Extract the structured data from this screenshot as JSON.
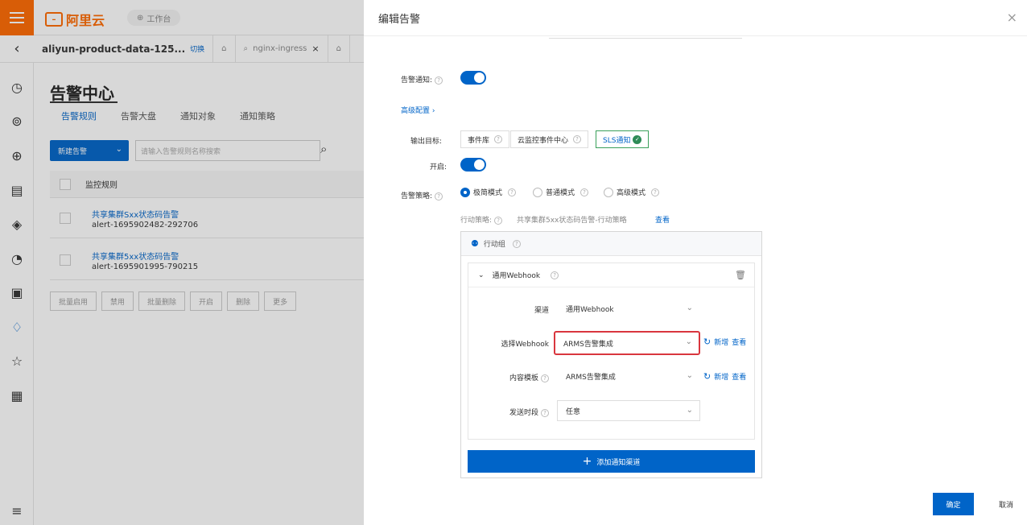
{
  "app": {
    "logo_text": "阿里云",
    "workspace_label": "工作台"
  },
  "tabs": [
    {
      "label": "aliyun-product-data-125...",
      "badge": "切换"
    },
    {
      "label": "nginx-ingress"
    }
  ],
  "page": {
    "title": "告警中心",
    "subtabs": [
      "告警规则",
      "告警大盘",
      "通知对象",
      "通知策略"
    ],
    "new_button": "新建告警",
    "search_placeholder": "请输入告警规则名称搜索",
    "table_header": "监控规则",
    "rows": [
      {
        "name": "共享集群Sxx状态码告警",
        "id": "alert-1695902482-292706"
      },
      {
        "name": "共享集群5xx状态码告警",
        "id": "alert-1695901995-790215"
      }
    ],
    "bulk_actions": [
      "批量启用",
      "禁用",
      "批量删除",
      "开启",
      "删除",
      "更多"
    ]
  },
  "drawer": {
    "title": "编辑告警",
    "notify_label": "告警通知:",
    "advanced_link": "高级配置",
    "output_label": "输出目标:",
    "output_targets": [
      "事件库",
      "云监控事件中心",
      "SLS通知"
    ],
    "enable_label": "开启:",
    "policy_label": "告警策略:",
    "policy_options": [
      "极简模式",
      "普通模式",
      "高级模式"
    ],
    "action_policy_label": "行动策略:",
    "action_policy_value": "共享集群5xx状态码告警-行动策略",
    "view_link": "查看",
    "action_group_label": "行动组",
    "webhook_group_label": "通用Webhook",
    "channel_label": "渠道",
    "channel_value": "通用Webhook",
    "select_webhook_label": "选择Webhook",
    "select_webhook_value": "ARMS告警集成",
    "content_template_label": "内容模板",
    "content_template_value": "ARMS告警集成",
    "send_period_label": "发送时段",
    "send_period_value": "任意",
    "new_link": "新增",
    "view_link_2": "查看",
    "add_channel_button": "添加通知渠道",
    "ok_button": "确定",
    "cancel_button": "取消"
  },
  "colors": {
    "accent": "#0064c8",
    "brand": "#ff6a00",
    "highlight": "#d9363e"
  }
}
